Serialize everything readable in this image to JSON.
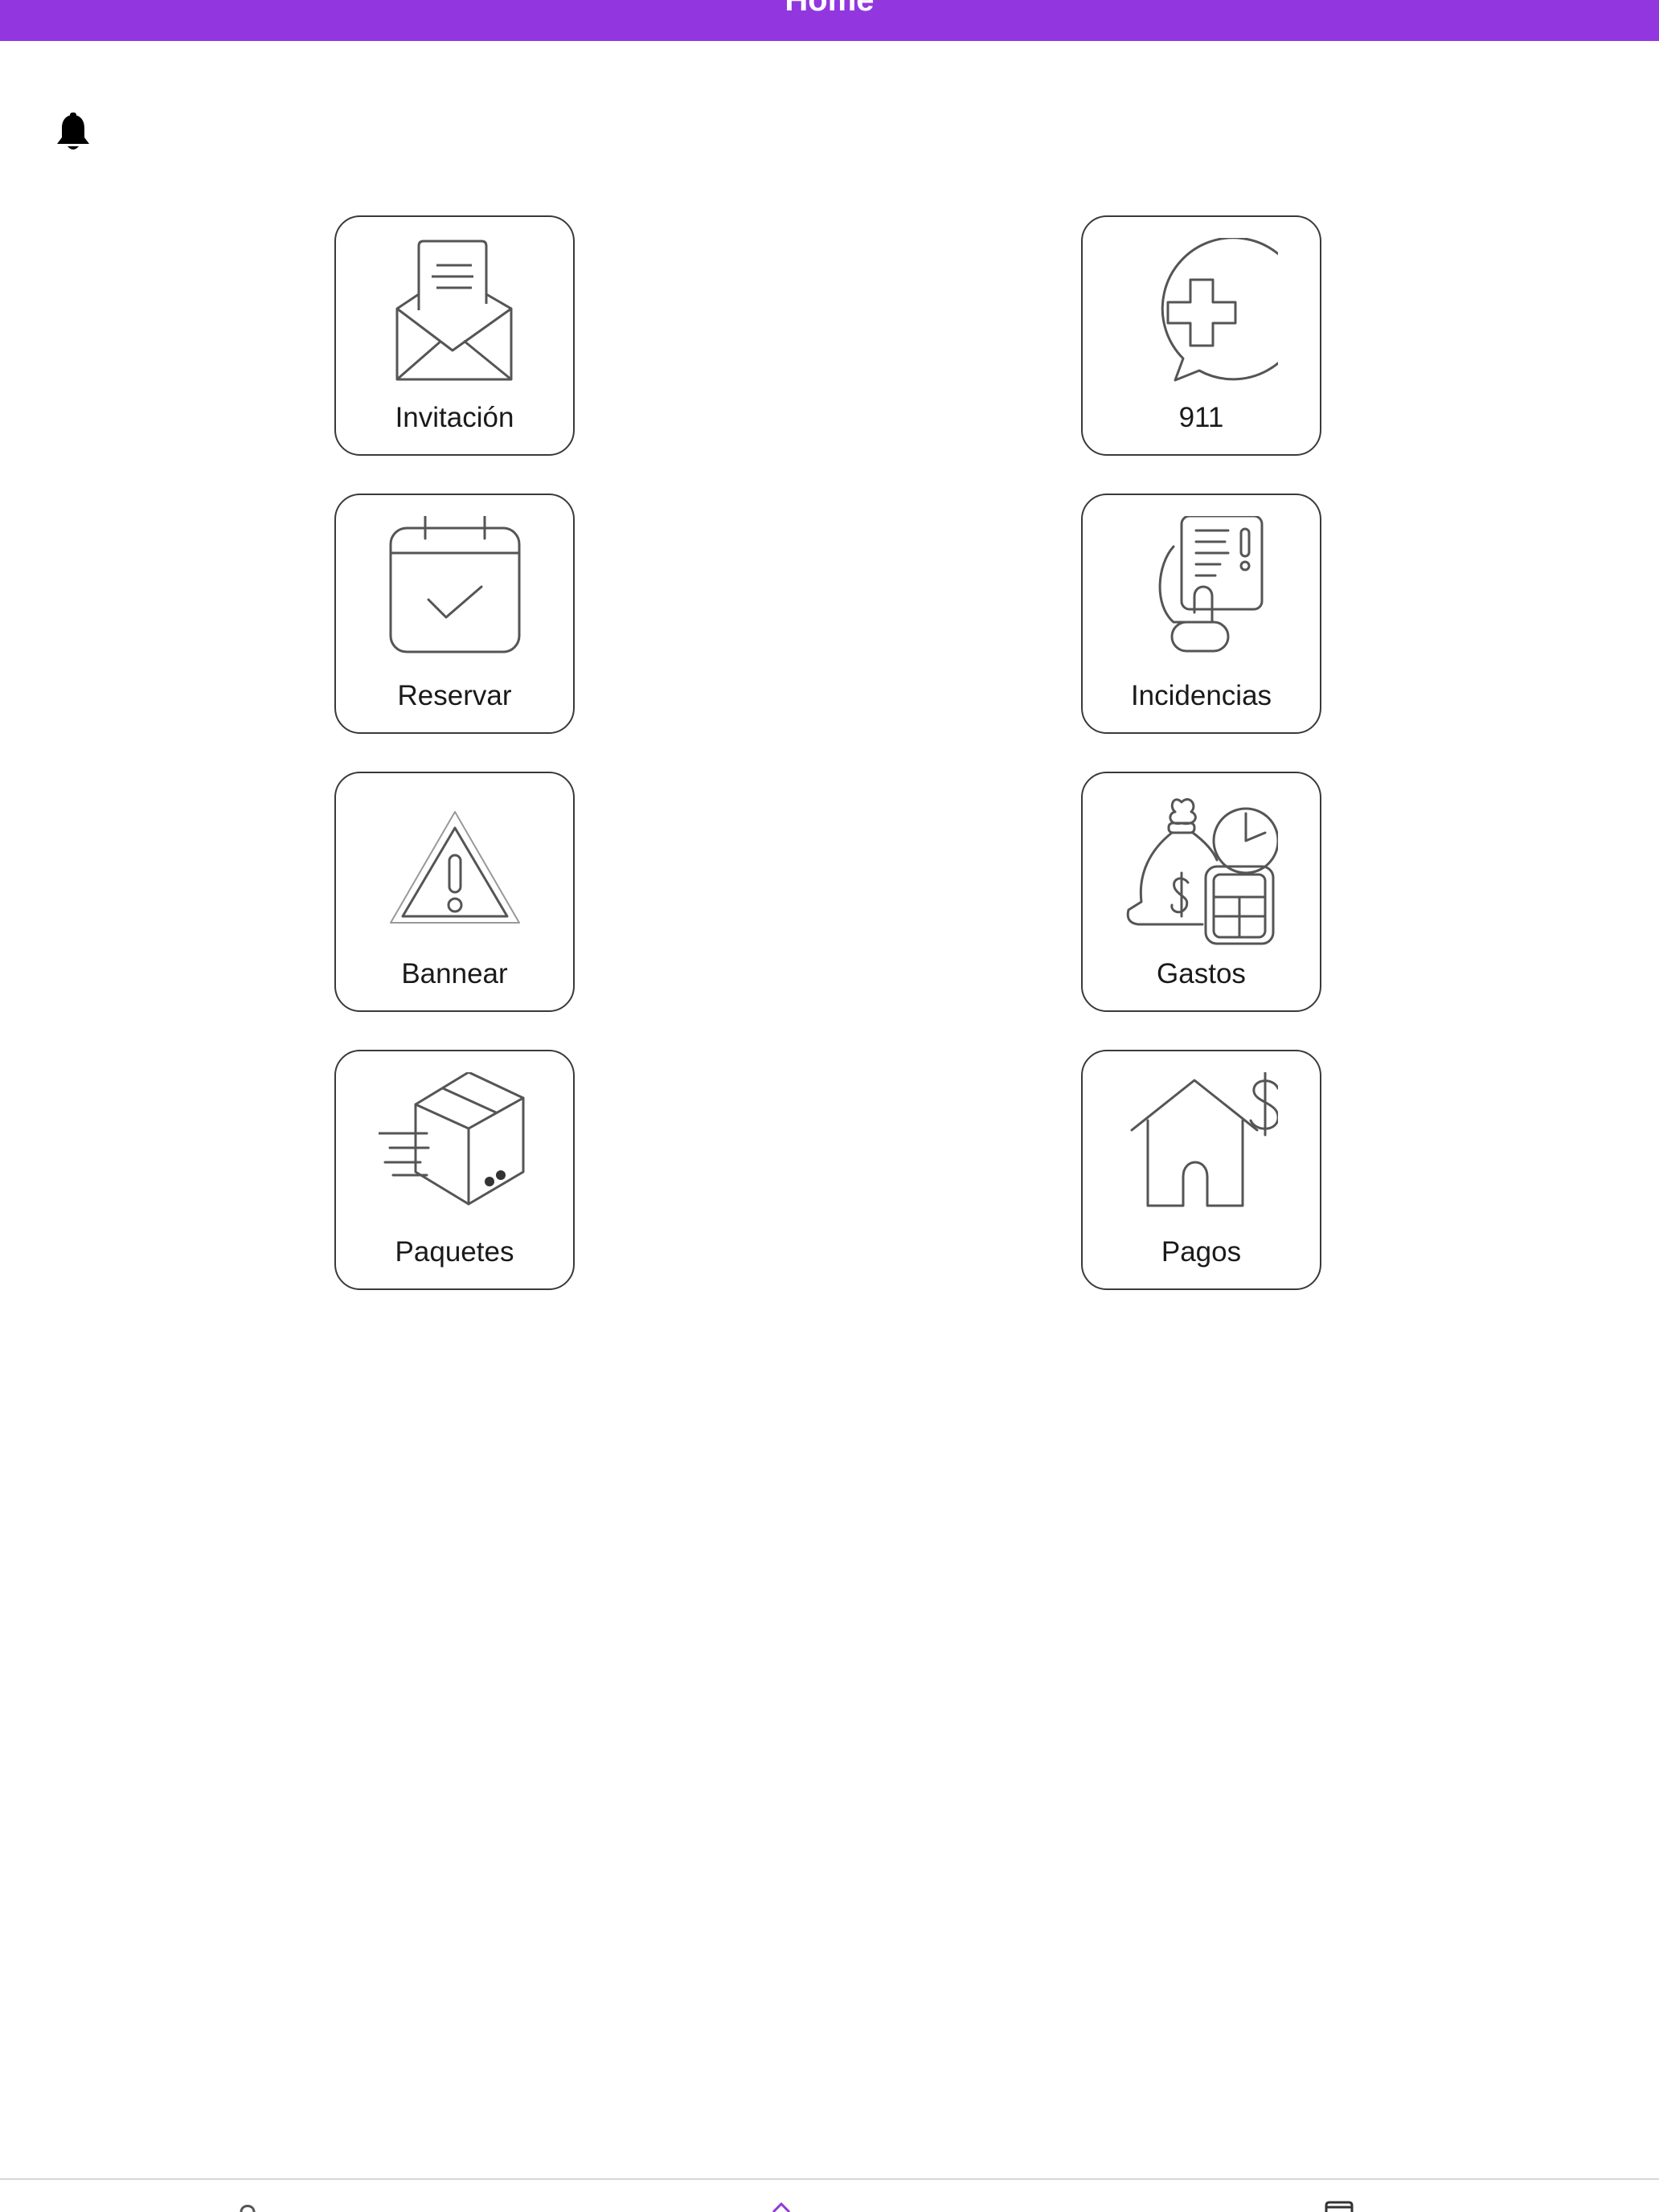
{
  "header": {
    "title": "Home",
    "color": "#9237df"
  },
  "notifications": {
    "icon": "bell-icon"
  },
  "tiles": [
    {
      "label": "Invitación",
      "icon": "envelope-letter-icon"
    },
    {
      "label": "911",
      "icon": "medical-chat-icon"
    },
    {
      "label": "Reservar",
      "icon": "calendar-check-icon"
    },
    {
      "label": "Incidencias",
      "icon": "hand-report-icon"
    },
    {
      "label": "Bannear",
      "icon": "warning-triangle-icon"
    },
    {
      "label": "Gastos",
      "icon": "money-bag-calculator-icon"
    },
    {
      "label": "Paquetes",
      "icon": "package-box-icon"
    },
    {
      "label": "Pagos",
      "icon": "house-dollar-icon"
    }
  ],
  "tab_bar": {
    "items": [
      {
        "icon": "profile-icon",
        "active": false
      },
      {
        "icon": "home-icon",
        "active": true
      },
      {
        "icon": "calendar-icon",
        "active": false
      }
    ],
    "active_color": "#9237df"
  }
}
